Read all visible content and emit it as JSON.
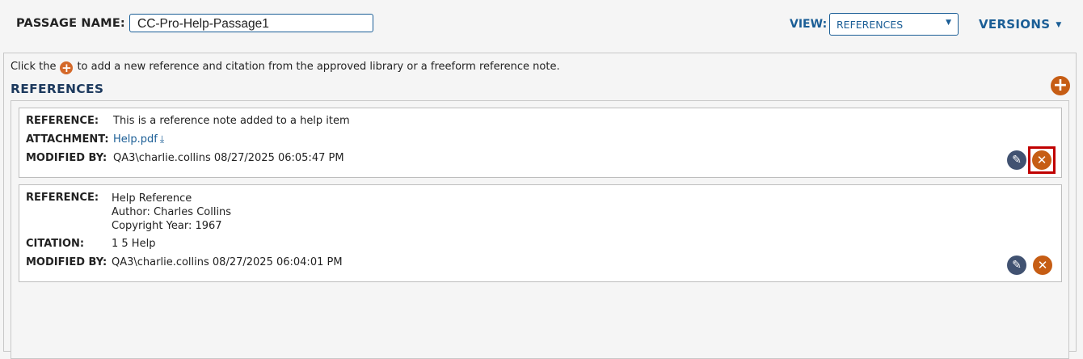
{
  "header": {
    "passage_label": "PASSAGE NAME:",
    "passage_value": "CC-Pro-Help-Passage1",
    "view_label": "VIEW:",
    "view_selected": "REFERENCES",
    "versions_label": "VERSIONS"
  },
  "panel": {
    "hint_before": "Click the",
    "hint_after": "to add a new reference and citation from the approved library or a freeform reference note.",
    "title": "REFERENCES"
  },
  "references": [
    {
      "reference_label": "REFERENCE:",
      "reference_text": "This is a reference note added to a help item",
      "attachment_label": "ATTACHMENT:",
      "attachment_file": "Help.pdf",
      "modified_label": "MODIFIED BY:",
      "modified_value": "QA3\\charlie.collins 08/27/2025 06:05:47 PM"
    },
    {
      "reference_label": "REFERENCE:",
      "reference_lines": [
        "Help Reference",
        "Author: Charles Collins",
        "Copyright Year: 1967"
      ],
      "citation_label": "CITATION:",
      "citation_value": "1 5 Help",
      "modified_label": "MODIFIED BY:",
      "modified_value": "QA3\\charlie.collins 08/27/2025 06:04:01 PM"
    }
  ],
  "icons": {
    "add": "plus-circle-icon",
    "edit": "pencil-icon",
    "delete": "close-circle-icon",
    "download": "download-icon",
    "dropdown": "caret-down-icon"
  },
  "colors": {
    "brand_blue": "#1b5e96",
    "accent_orange": "#c65d14",
    "edit_slate": "#415271",
    "highlight_red": "#c00000"
  }
}
